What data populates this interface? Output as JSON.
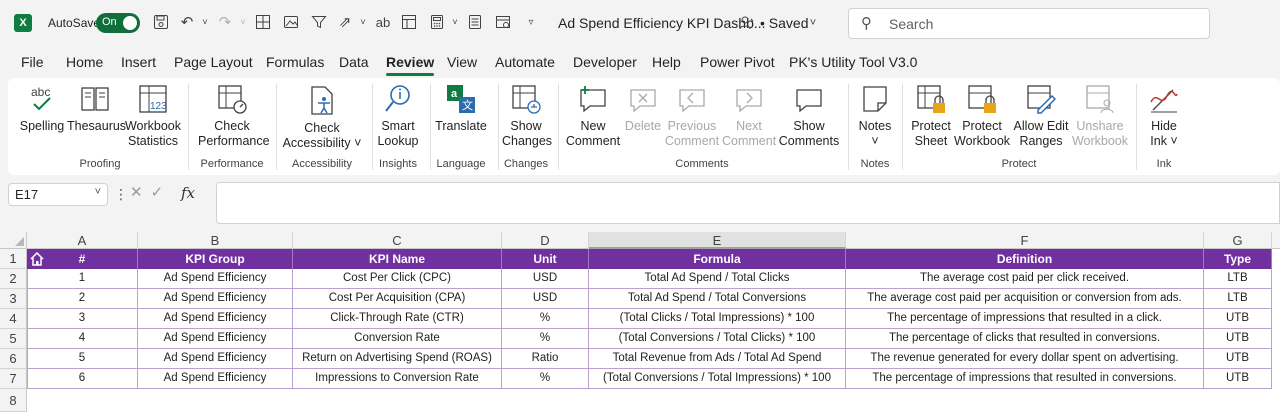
{
  "titlebar": {
    "autosave_label": "AutoSave",
    "autosave_state": "On",
    "doc_title": "Ad Spend Efficiency KPI Dashb...",
    "saved_status": "• Saved",
    "search_placeholder": "Search"
  },
  "menu_tabs": [
    "File",
    "Home",
    "Insert",
    "Page Layout",
    "Formulas",
    "Data",
    "Review",
    "View",
    "Automate",
    "Developer",
    "Help",
    "Power Pivot",
    "PK's Utility Tool V3.0"
  ],
  "active_tab": "Review",
  "ribbon": {
    "spelling": [
      "Spelling",
      ""
    ],
    "thesaurus": [
      "Thesaurus",
      ""
    ],
    "workbook_statistics": [
      "Workbook",
      "Statistics"
    ],
    "check_performance": [
      "Check",
      "Performance"
    ],
    "check_accessibility": [
      "Check",
      "Accessibility ˅"
    ],
    "smart_lookup": [
      "Smart",
      "Lookup"
    ],
    "translate": [
      "Translate",
      ""
    ],
    "show_changes": [
      "Show",
      "Changes"
    ],
    "new_comment": [
      "New",
      "Comment"
    ],
    "delete": [
      "Delete",
      ""
    ],
    "previous_comment": [
      "Previous",
      "Comment"
    ],
    "next_comment": [
      "Next",
      "Comment"
    ],
    "show_comments": [
      "Show",
      "Comments"
    ],
    "notes": [
      "Notes",
      "˅"
    ],
    "protect_sheet": [
      "Protect",
      "Sheet"
    ],
    "protect_workbook": [
      "Protect",
      "Workbook"
    ],
    "allow_edit_ranges": [
      "Allow Edit",
      "Ranges"
    ],
    "unshare_workbook": [
      "Unshare",
      "Workbook"
    ],
    "hide_ink": [
      "Hide",
      "Ink ˅"
    ],
    "groups": {
      "proofing": "Proofing",
      "performance": "Performance",
      "accessibility": "Accessibility",
      "insights": "Insights",
      "language": "Language",
      "changes": "Changes",
      "comments": "Comments",
      "notes": "Notes",
      "protect": "Protect",
      "ink": "Ink"
    }
  },
  "formula_bar": {
    "name_box": "E17",
    "fx": "fx",
    "value": ""
  },
  "sheet": {
    "column_letters": [
      "A",
      "B",
      "C",
      "D",
      "E",
      "F",
      "G"
    ],
    "row_numbers": [
      "1",
      "2",
      "3",
      "4",
      "5",
      "6",
      "7",
      "8"
    ],
    "headers": [
      "#",
      "KPI Group",
      "KPI Name",
      "Unit",
      "Formula",
      "Definition",
      "Type"
    ],
    "rows": [
      [
        "1",
        "Ad Spend Efficiency",
        "Cost Per Click (CPC)",
        "USD",
        "Total Ad Spend / Total Clicks",
        "The average cost paid per click received.",
        "LTB"
      ],
      [
        "2",
        "Ad Spend Efficiency",
        "Cost Per Acquisition (CPA)",
        "USD",
        "Total Ad Spend / Total Conversions",
        "The average cost paid per acquisition or conversion from ads.",
        "LTB"
      ],
      [
        "3",
        "Ad Spend Efficiency",
        "Click-Through Rate (CTR)",
        "%",
        "(Total Clicks / Total Impressions) * 100",
        "The percentage of impressions that resulted in a click.",
        "UTB"
      ],
      [
        "4",
        "Ad Spend Efficiency",
        "Conversion Rate",
        "%",
        "(Total Conversions / Total Clicks) * 100",
        "The percentage of clicks that resulted in conversions.",
        "UTB"
      ],
      [
        "5",
        "Ad Spend Efficiency",
        "Return on Advertising Spend (ROAS)",
        "Ratio",
        "Total Revenue from Ads / Total Ad Spend",
        "The revenue generated for every dollar spent on advertising.",
        "UTB"
      ],
      [
        "6",
        "Ad Spend Efficiency",
        "Impressions to Conversion Rate",
        "%",
        "(Total Conversions / Total Impressions) * 100",
        "The percentage of impressions that resulted in conversions.",
        "UTB"
      ]
    ]
  },
  "colors": {
    "accent": "#107c41",
    "header_fill": "#7030a0"
  }
}
